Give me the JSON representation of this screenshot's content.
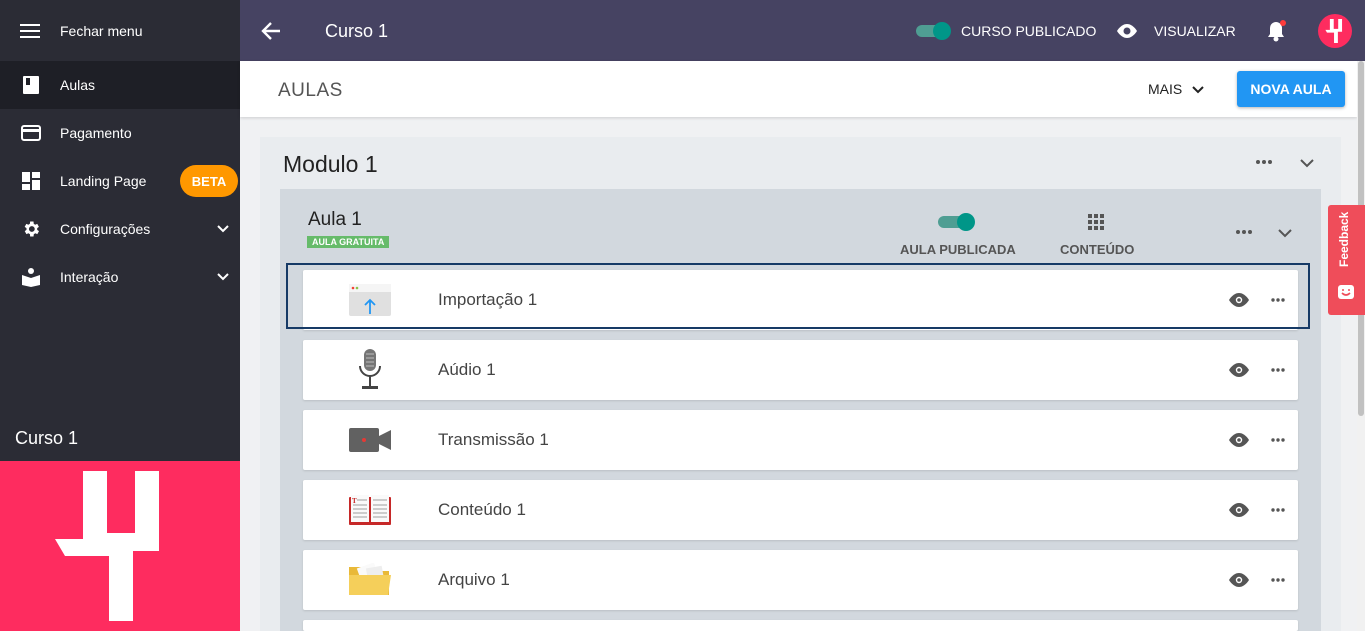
{
  "sidebar": {
    "menu_label": "Fechar menu",
    "items": [
      {
        "label": "Aulas",
        "icon": "book-icon"
      },
      {
        "label": "Pagamento",
        "icon": "credit-card-icon"
      },
      {
        "label": "Landing Page",
        "icon": "dashboard-icon",
        "badge": "BETA"
      },
      {
        "label": "Configurações",
        "icon": "gear-icon"
      },
      {
        "label": "Interação",
        "icon": "reader-icon"
      }
    ],
    "course_name": "Curso 1"
  },
  "topbar": {
    "title": "Curso 1",
    "published_label": "CURSO PUBLICADO",
    "view_label": "VISUALIZAR"
  },
  "subbar": {
    "title": "AULAS",
    "more_label": "MAIS",
    "new_lesson_label": "NOVA AULA"
  },
  "module": {
    "title": "Modulo 1",
    "lesson": {
      "title": "Aula 1",
      "badge": "AULA GRATUITA",
      "published_label": "AULA PUBLICADA",
      "content_label": "CONTEÚDO",
      "items": [
        {
          "name": "Importação 1",
          "icon": "import-icon"
        },
        {
          "name": "Aúdio 1",
          "icon": "microphone-icon"
        },
        {
          "name": "Transmissão 1",
          "icon": "video-camera-icon"
        },
        {
          "name": "Conteúdo 1",
          "icon": "open-book-icon"
        },
        {
          "name": "Arquivo 1",
          "icon": "folder-icon"
        }
      ]
    }
  },
  "feedback_label": "Feedback",
  "colors": {
    "brand": "#fe2c5f",
    "toggle": "#009688",
    "primary": "#2196f3",
    "sidebar": "#2b2c35",
    "topbar": "#464362"
  }
}
